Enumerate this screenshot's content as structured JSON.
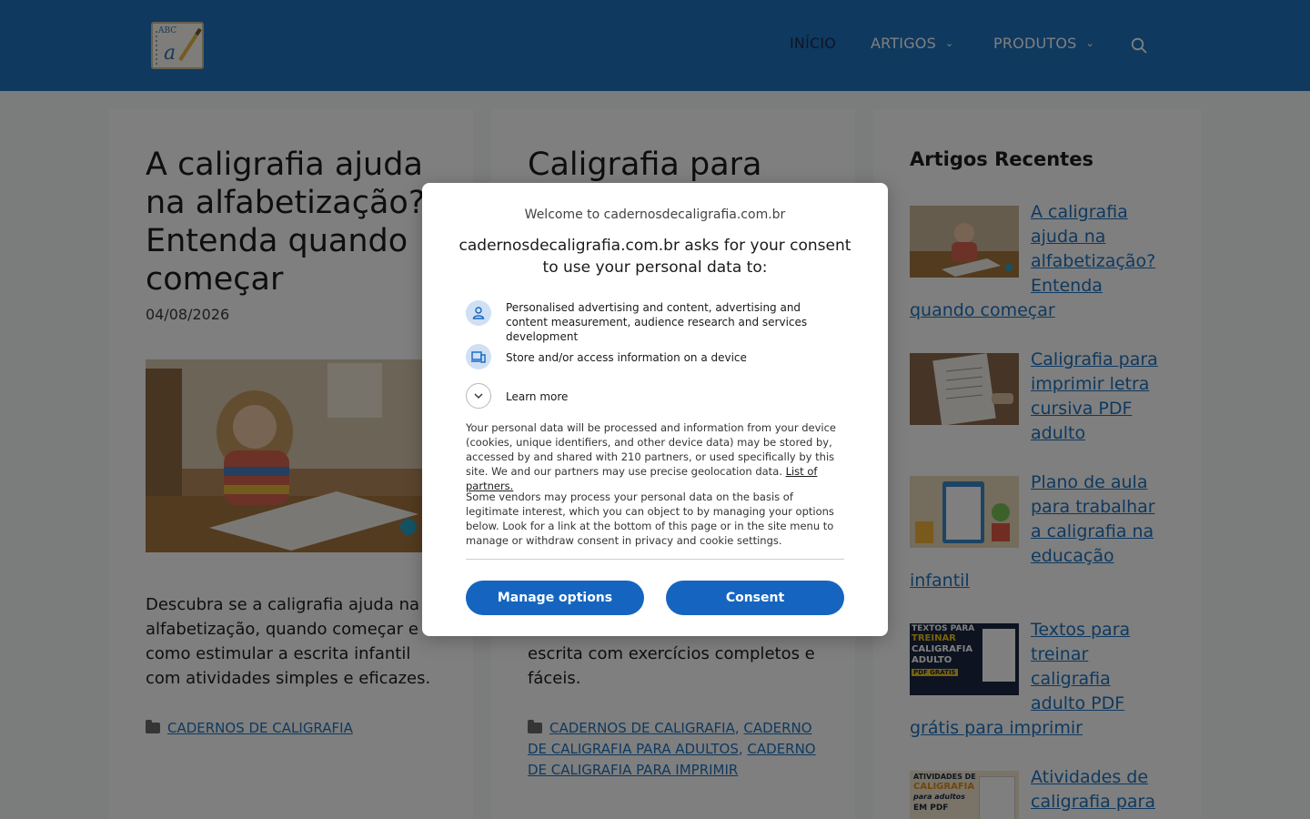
{
  "header": {
    "logo_text": "ABC",
    "logo_cursive": "a",
    "nav": [
      {
        "label": "INÍCIO"
      },
      {
        "label": "ARTIGOS"
      },
      {
        "label": "PRODUTOS"
      }
    ],
    "caret": "⌄",
    "colors": {
      "bar": "#1e73be",
      "active": "#1b2b4a"
    }
  },
  "posts": [
    {
      "title": "A caligrafia ajuda na alfabetização? Entenda quando começar",
      "date": "04/08/2026",
      "excerpt": "Descubra se a caligrafia ajuda na alfabetização, quando começar e como estimular a escrita infantil com atividades simples e eficazes.",
      "categories": [
        "CADERNOS DE CALIGRAFIA"
      ]
    },
    {
      "title": "Caligrafia para",
      "excerpt": "escrita com exercícios completos e fáceis.",
      "categories": [
        "CADERNOS DE CALIGRAFIA",
        "CADERNO DE CALIGRAFIA PARA ADULTOS",
        "CADERNO DE CALIGRAFIA PARA IMPRIMIR"
      ]
    }
  ],
  "sidebar": {
    "title": "Artigos Recentes",
    "items": [
      {
        "label": "A caligrafia ajuda na alfabetização? Entenda quando começar"
      },
      {
        "label": "Caligrafia para imprimir letra cursiva PDF adulto"
      },
      {
        "label": "Plano de aula para trabalhar a caligrafia na educação infantil"
      },
      {
        "label": "Textos para treinar caligrafia adulto PDF grátis para imprimir"
      },
      {
        "label": "Atividades de caligrafia para"
      }
    ],
    "thumb_texts": {
      "item4_line1": "TEXTOS PARA",
      "item4_line2": "TREINAR",
      "item4_line3": "CALIGRAFIA",
      "item4_line4": "ADULTO",
      "item4_badge": "PDF GRÁTIS",
      "item5_line1": "ATIVIDADES DE",
      "item5_line2": "CALIGRAFIA",
      "item5_line3": "para adultos",
      "item5_line4": "EM PDF"
    }
  },
  "modal": {
    "welcome": "Welcome to cadernosdecaligrafia.com.br",
    "heading": "cadernosdecaligrafia.com.br asks for your consent to use your personal data to:",
    "purposes": [
      {
        "icon": "person-icon",
        "text": "Personalised advertising and content, advertising and content measurement, audience research and services development"
      },
      {
        "icon": "device-icon",
        "text": "Store and/or access information on a device"
      }
    ],
    "learn_more": "Learn more",
    "para1": "Your personal data will be processed and information from your device (cookies, unique identifiers, and other device data) may be stored by, accessed by and shared with 210 partners, or used specifically by this site. We and our partners may use precise geolocation data.",
    "partners_link": "List of partners.",
    "para2": "Some vendors may process your personal data on the basis of legitimate interest, which you can object to by managing your options below. Look for a link at the bottom of this page or in the site menu to manage or withdraw consent in privacy and cookie settings.",
    "manage_button": "Manage options",
    "consent_button": "Consent",
    "colors": {
      "button": "#1565c0",
      "icon_bg": "#cfe0f5"
    }
  }
}
